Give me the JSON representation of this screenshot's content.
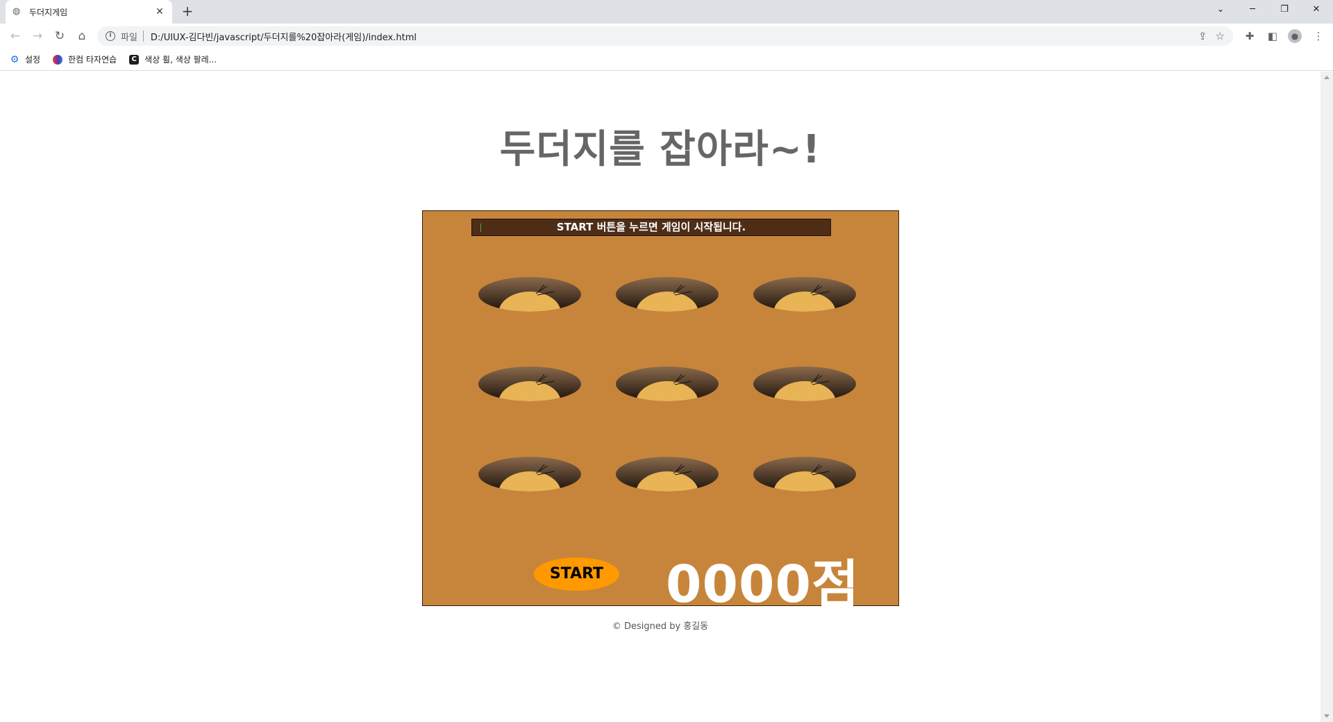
{
  "browser": {
    "tab_title": "두더지게임",
    "tab_close": "✕",
    "new_tab": "+",
    "scheme_label": "파일",
    "url": "D:/UIUX-김다빈/javascript/두더지를%20잡아라(게임)/index.html",
    "bookmarks": [
      {
        "label": "설정",
        "icon": "gear-icon"
      },
      {
        "label": "한컴 타자연습",
        "icon": "hancom-icon"
      },
      {
        "label": "색상 휠, 색상 팔레...",
        "icon": "color-wheel-icon"
      }
    ]
  },
  "page": {
    "title": "두더지를 잡아라~!",
    "message": "START 버튼을 누르면 게임이 시작됩니다.",
    "start_label": "START",
    "score": "0000점",
    "footer": "© Designed by 홍길동"
  },
  "colors": {
    "board": "#c7853b",
    "message_bar": "#4e2d17",
    "start_button": "#ff9900",
    "mole": "#e8b455",
    "title": "#666666"
  }
}
